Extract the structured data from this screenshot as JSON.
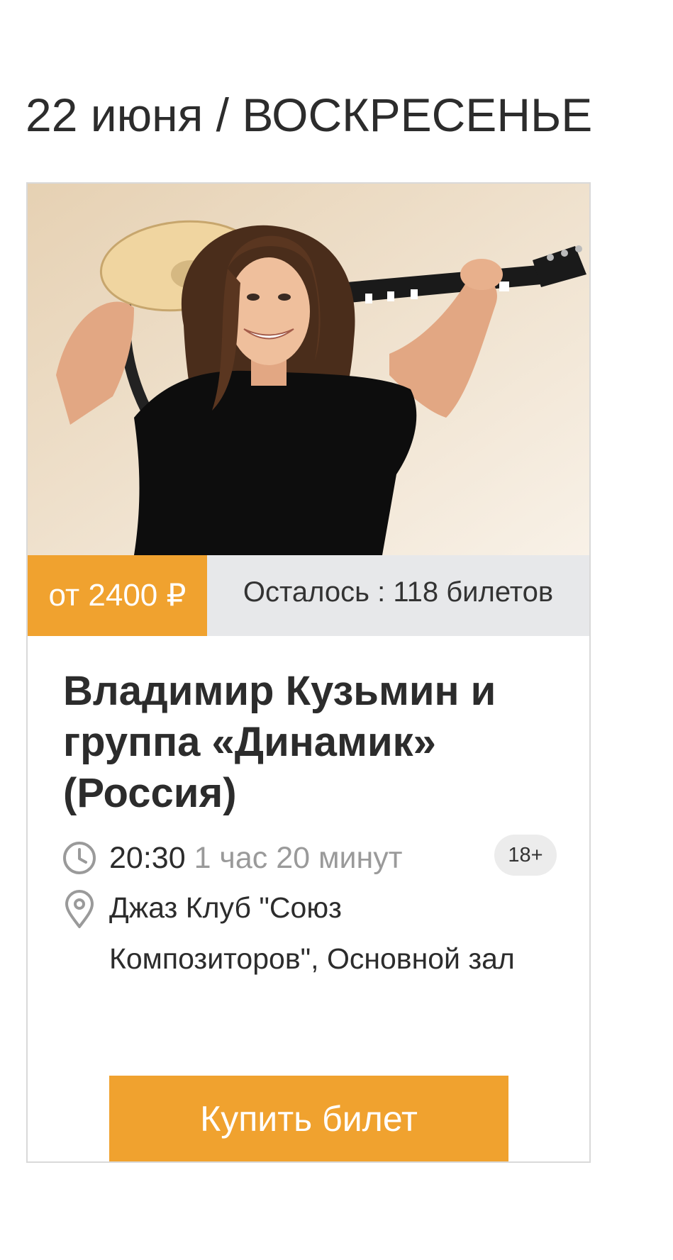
{
  "date_heading": "22 июня / ВОСКРЕСЕНЬЕ",
  "event": {
    "photo_alt": "Фото исполнителя с гитарой",
    "price": "от 2400 ₽",
    "tickets_left": "Осталось : 118 билетов",
    "title": "Владимир Кузьмин и группа «Динамик» (Россия)",
    "time": "20:30",
    "duration": "1 час 20 минут",
    "age_rating": "18+",
    "venue": "Джаз Клуб \"Союз Композиторов\", Основной зал",
    "buy_label": "Купить билет"
  },
  "icons": {
    "time": "clock-icon",
    "venue": "map-pin-icon"
  },
  "colors": {
    "accent": "#f0a22f",
    "tickets_bg": "#e7e8ea",
    "card_border": "#d9d9d9",
    "muted_text": "#9a9a9a"
  }
}
